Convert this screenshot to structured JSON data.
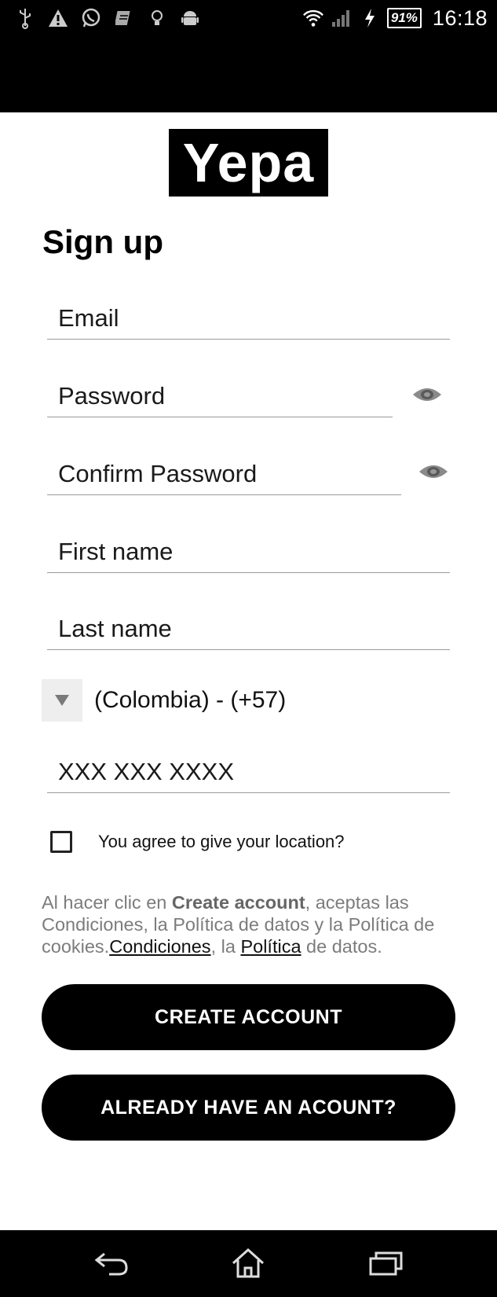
{
  "status_bar": {
    "left_icons": [
      "usb-icon",
      "warning-icon",
      "whatsapp-icon",
      "app-icon",
      "lightbulb-icon",
      "android-icon"
    ],
    "battery": "91%",
    "time": "16:18"
  },
  "logo": {
    "text": "Yepa"
  },
  "title": "Sign up",
  "form": {
    "email_placeholder": "Email",
    "password_placeholder": "Password",
    "confirm_password_placeholder": "Confirm Password",
    "first_name_placeholder": "First name",
    "last_name_placeholder": "Last name",
    "country_value": "(Colombia) - (+57)",
    "phone_placeholder": "XXX XXX XXXX",
    "location_consent_label": "You agree to give your location?"
  },
  "legal": {
    "p1": "Al hacer clic en ",
    "bold_create": "Create account",
    "p2": ", aceptas las Condiciones, la Política de datos y la Política de cookies.",
    "link_conditions": "Condiciones",
    "p3": ", la ",
    "link_policy": "Política",
    "p4": " de datos."
  },
  "buttons": {
    "create_account": "CREATE ACCOUNT",
    "already_have": "ALREADY HAVE AN ACOUNT?"
  },
  "nav_bar": {
    "icons": [
      "back-icon",
      "home-icon",
      "recent-apps-icon"
    ]
  },
  "colors": {
    "primary": "#000000",
    "background": "#ffffff",
    "muted_text": "#7c7c7c",
    "underline": "#9a9a9a"
  }
}
